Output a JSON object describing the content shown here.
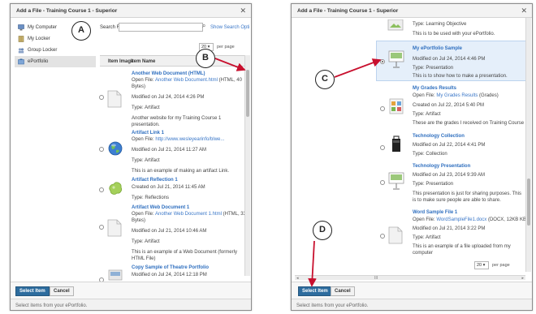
{
  "left": {
    "title": "Add a File - Training Course 1 - Superior",
    "nav": [
      "My Computer",
      "My Locker",
      "Group Locker",
      "ePortfolio"
    ],
    "search_label": "Search For",
    "search_placeholder": "",
    "search_options": "Show Search Opti",
    "per_page": "20",
    "per_page_label": "per page",
    "col_image": "Item Image",
    "col_name": "Item Name",
    "items": [
      {
        "title": "Another Web Document (HTML)",
        "open_prefix": "Open File:",
        "open_link": "Another Web Document.html",
        "open_size": "(HTML, 40",
        "line2": "Bytes)",
        "modified": "Modified on Jul 24, 2014 4:26 PM",
        "type": "Type: Artifact",
        "desc1": "Another website for my Training Course 1",
        "desc2": "presentation."
      },
      {
        "title": "Artifact Link 1",
        "open_prefix": "Open File:",
        "open_link": "http://www.wesleyearinfo/blwe...",
        "modified": "Modified on Jul 21, 2014 11:27 AM",
        "type": "Type: Artifact",
        "desc1": "This is an example of making an artifact Link."
      },
      {
        "title": "Artifact Reflection 1",
        "modified": "Created on Jul 21, 2014 11:45 AM",
        "type": "Type: Reflections"
      },
      {
        "title": "Artifact Web Document 1",
        "open_prefix": "Open File:",
        "open_link": "Another Web Document 1.html",
        "open_size": "(HTML, 33",
        "line2": "Bytes)",
        "modified": "Modified on Jul 21, 2014 10:46 AM",
        "type": "Type: Artifact",
        "desc1": "This is an example of a Web Document (formerly",
        "desc2": "HTML File)"
      },
      {
        "title": "Copy Sample of Theatre Portfolio",
        "modified": "Modified on Jul 24, 2014 12:18 PM"
      }
    ],
    "select_button": "Select Item",
    "cancel_button": "Cancel",
    "footer": "Select items from your ePortfolio."
  },
  "right": {
    "title": "Add a File - Training Course 1 - Superior",
    "items": [
      {
        "type": "Type: Learning Objective",
        "desc1": "This is to be used with your ePortfolio."
      },
      {
        "title": "My ePortfolio Sample",
        "modified": "Modified on Jul 24, 2014 4:46 PM",
        "type": "Type: Presentation",
        "desc1": "This is to show how to make a presentation."
      },
      {
        "title": "My Grades Results",
        "open_prefix": "Open File:",
        "open_link": "My Grades Results",
        "open_size": "(Grades)",
        "modified": "Created on Jul 22, 2014 5:40 PM",
        "type": "Type: Artifact",
        "desc1": "These are the grades I received on Training Course 1"
      },
      {
        "title": "Technology Collection",
        "modified": "Modified on Jul 22, 2014 4:41 PM",
        "type": "Type: Collection"
      },
      {
        "title": "Technology Presentation",
        "modified": "Modified on Jul 23, 2014 9:39 AM",
        "type": "Type: Presentation",
        "desc1": "This presentation is just for sharing purposes.  This",
        "desc2": "is to make sure people are able to share."
      },
      {
        "title": "Word Sample File 1",
        "open_prefix": "Open File:",
        "open_link": "WordSampleFile1.docx",
        "open_size": "(DOCX, 12KB KB)",
        "modified": "Modified on Jul 21, 2014 3:22 PM",
        "type": "Type: Artifact",
        "desc1": "This is an example of a file uploaded from my",
        "desc2": "computer"
      }
    ],
    "per_page": "20",
    "per_page_label": "per page",
    "select_button": "Select Item",
    "cancel_button": "Cancel",
    "footer": "Select items from your ePortfolio."
  },
  "callouts": {
    "a": "A",
    "b": "B",
    "c": "C",
    "d": "D"
  },
  "colors": {
    "link": "#2f6fbf",
    "primary_button": "#2d6c9e",
    "annotation_arrow": "#c8102e",
    "selected_row": "#e5effa"
  }
}
